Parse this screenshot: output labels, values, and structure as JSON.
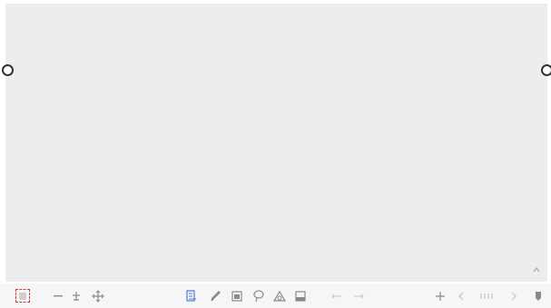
{
  "canvas": {
    "background": "#ededed"
  },
  "toolbar": {
    "zoom_label": "",
    "page_indicator": "",
    "icons": {
      "pages": "pages-thumbnail-icon",
      "zoom_out": "zoom-out-icon",
      "zoom_in": "zoom-in-icon",
      "move": "move-icon",
      "select": "select-icon",
      "pen": "pen-icon",
      "eraser": "eraser-icon",
      "lasso": "lasso-icon",
      "shape": "shape-icon",
      "fill": "fill-icon",
      "undo": "undo-icon",
      "redo": "redo-icon",
      "add_page": "add-page-icon",
      "prev_page": "previous-page-icon",
      "next_page": "next-page-icon",
      "menu": "menu-icon"
    },
    "accent": "#4a7bd0"
  }
}
